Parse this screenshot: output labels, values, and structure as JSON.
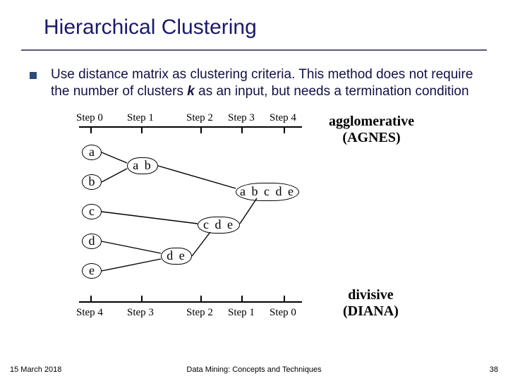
{
  "title": "Hierarchical Clustering",
  "bullet": {
    "pre": "Use distance matrix as clustering criteria.  This method does not require the number of clusters ",
    "k": "k",
    "post": " as an input, but needs a termination condition"
  },
  "steps_top": [
    "Step 0",
    "Step 1",
    "Step 2",
    "Step 3",
    "Step 4"
  ],
  "steps_bot": [
    "Step 4",
    "Step 3",
    "Step 2",
    "Step 1",
    "Step 0"
  ],
  "leaves": [
    "a",
    "b",
    "c",
    "d",
    "e"
  ],
  "nodes": {
    "ab": "a b",
    "de": "d e",
    "cde": "c d e",
    "abcde": "a b c d e"
  },
  "labels": {
    "agnes1": "agglomerative",
    "agnes2": "(AGNES)",
    "diana1": "divisive",
    "diana2": "(DIANA)"
  },
  "footer": {
    "date": "15 March 2018",
    "center": "Data Mining: Concepts and Techniques",
    "page": "38"
  }
}
